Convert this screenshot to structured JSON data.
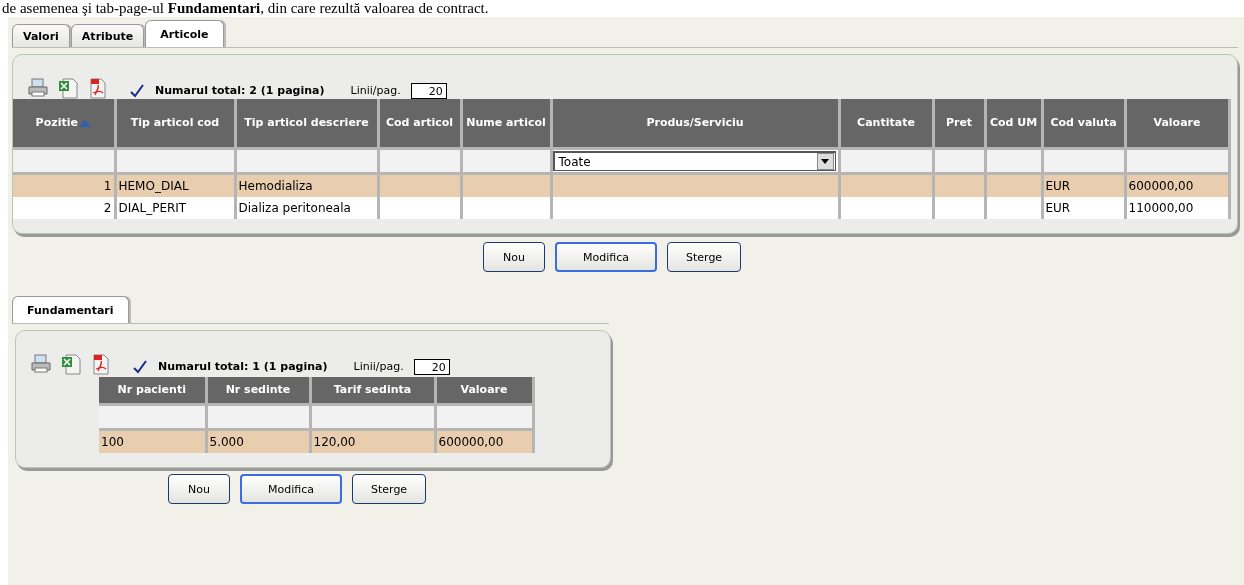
{
  "intro_text": "de asemenea şi tab-page-ul **Fundamentari**, din care rezultă valoarea de contract.",
  "tabs": [
    {
      "label": "Valori",
      "selected": false
    },
    {
      "label": "Atribute",
      "selected": false
    },
    {
      "label": "Articole",
      "selected": true
    }
  ],
  "articole": {
    "total": "Numarul total: 2 (1 pagina)",
    "lines_label": "Linii/pag.",
    "lines_value": "20",
    "columns": [
      {
        "label": "Pozitie",
        "sorted": true
      },
      {
        "label": "Tip articol cod",
        "sorted": false
      },
      {
        "label": "Tip articol descriere",
        "sorted": false
      },
      {
        "label": "Cod articol",
        "sorted": false
      },
      {
        "label": "Nume articol",
        "sorted": false
      },
      {
        "label": "Produs/Serviciu",
        "sorted": false
      },
      {
        "label": "Cantitate",
        "sorted": false
      },
      {
        "label": "Pret",
        "sorted": false
      },
      {
        "label": "Cod UM",
        "sorted": false
      },
      {
        "label": "Cod valuta",
        "sorted": false
      },
      {
        "label": "Valoare",
        "sorted": false
      }
    ],
    "filter_select": "Toate",
    "rows": [
      {
        "selected": true,
        "cells": [
          "1",
          "HEMO_DIAL",
          "Hemodializa",
          "",
          "",
          "",
          "",
          "",
          "",
          "EUR",
          "600000,00"
        ]
      },
      {
        "selected": false,
        "cells": [
          "2",
          "DIAL_PERIT",
          "Dializa peritoneala",
          "",
          "",
          "",
          "",
          "",
          "",
          "EUR",
          "110000,00"
        ]
      }
    ],
    "buttons": [
      {
        "label": "Nou",
        "default": false
      },
      {
        "label": "Modifica",
        "default": true
      },
      {
        "label": "Sterge",
        "default": false
      }
    ]
  },
  "sub_tab": {
    "label": "Fundamentari",
    "selected": true
  },
  "fundamentari": {
    "total": "Numarul total: 1 (1 pagina)",
    "lines_label": "Linii/pag.",
    "lines_value": "20",
    "columns": [
      "Nr pacienti",
      "Nr sedinte",
      "Tarif sedinta",
      "Valoare"
    ],
    "rows": [
      {
        "selected": true,
        "cells": [
          "100",
          "5.000",
          "120,00",
          "600000,00"
        ]
      }
    ],
    "buttons": [
      {
        "label": "Nou",
        "default": false
      },
      {
        "label": "Modifica",
        "default": true
      },
      {
        "label": "Sterge",
        "default": false
      }
    ]
  }
}
